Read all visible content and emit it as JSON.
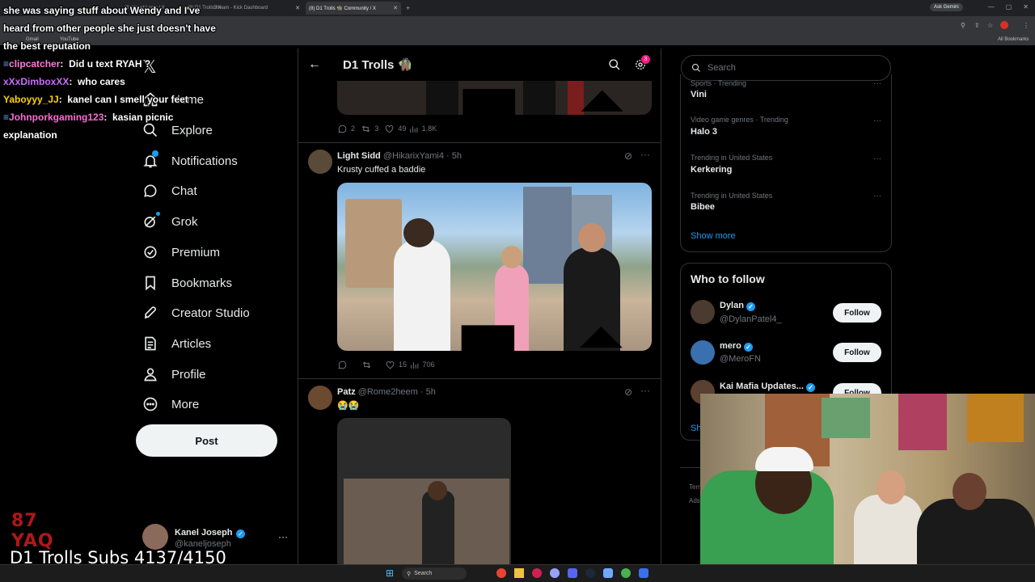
{
  "browser": {
    "tabs": [
      {
        "label": "(8) Weed Logic / X",
        "active": false
      },
      {
        "label": "(8) D1 Trolls / X",
        "active": false
      },
      {
        "label": "Stream - Kick Dashboard",
        "active": false
      },
      {
        "label": "(8) D1 Trolls 🧌 Community / X",
        "active": true
      }
    ],
    "ask_gemini": "Ask Gemini",
    "bookmarks": [
      "Gmail",
      "YouTube"
    ],
    "all_bookmarks": "All Bookmarks"
  },
  "stream_chat": [
    {
      "text": "she was saying stuff about Wendy and I've",
      "color": "#ffffff"
    },
    {
      "text": "heard from other people she just doesn't have",
      "color": "#ffffff"
    },
    {
      "text": "the best reputation",
      "color": "#ffffff"
    },
    {
      "user": "clipcatcher",
      "msg": "Did u text RYAH ?",
      "color": "#ff7ad9"
    },
    {
      "user": "xXxDimboxXX",
      "msg": "who cares",
      "color": "#c86bff"
    },
    {
      "user": "Yaboyyy_JJ",
      "msg": "kanel can I smell your feet",
      "color": "#ffd400"
    },
    {
      "user": "Johnporkgaming123",
      "msg": "kasian picnic",
      "color": "#ff6ad5"
    },
    {
      "text": "explanation",
      "color": "#ffffff"
    }
  ],
  "subs_counter": "D1 Trolls Subs 4137/4150",
  "logo_text": "87 YAQ",
  "nav": {
    "items": [
      {
        "label": "Home",
        "icon": "home-icon"
      },
      {
        "label": "Explore",
        "icon": "search-icon"
      },
      {
        "label": "Notifications",
        "icon": "bell-icon"
      },
      {
        "label": "Chat",
        "icon": "chat-icon"
      },
      {
        "label": "Grok",
        "icon": "grok-icon"
      },
      {
        "label": "Premium",
        "icon": "premium-icon"
      },
      {
        "label": "Bookmarks",
        "icon": "bookmark-icon"
      },
      {
        "label": "Creator Studio",
        "icon": "rocket-icon"
      },
      {
        "label": "Articles",
        "icon": "articles-icon"
      },
      {
        "label": "Profile",
        "icon": "profile-icon"
      },
      {
        "label": "More",
        "icon": "more-icon"
      }
    ],
    "post_label": "Post",
    "account": {
      "name": "Kanel Joseph",
      "handle": "@kaneljoseph"
    }
  },
  "community": {
    "title": "D1 Trolls 🧌",
    "settings_badge": "3"
  },
  "posts": [
    {
      "replies": "2",
      "reposts": "3",
      "likes": "49",
      "views": "1.8K"
    },
    {
      "author": "Light Sidd",
      "handle": "@HikarixYami4",
      "time": "· 5h",
      "text": "Krusty cuffed a baddie",
      "replies": "",
      "reposts": "",
      "likes": "15",
      "views": "706"
    },
    {
      "author": "Patz",
      "handle": "@Rome2heem",
      "time": "· 5h",
      "text": "😭😭"
    }
  ],
  "search": {
    "placeholder": "Search"
  },
  "trends": [
    {
      "meta": "Sports · Trending",
      "title": "Vini"
    },
    {
      "meta": "Video game genres · Trending",
      "title": "Halo 3"
    },
    {
      "meta": "Trending in United States",
      "title": "Kerkering"
    },
    {
      "meta": "Trending in United States",
      "title": "Bibee"
    }
  ],
  "show_more": "Show more",
  "who_to_follow": {
    "title": "Who to follow",
    "accounts": [
      {
        "name": "Dylan",
        "handle": "@DylanPatel4_",
        "follow": "Follow"
      },
      {
        "name": "mero",
        "handle": "@MeroFN",
        "follow": "Follow"
      },
      {
        "name": "Kai Mafia Updates...",
        "handle": "",
        "follow": "Follow"
      }
    ],
    "show_label": "Sh"
  },
  "footer_fragments": [
    "Terr",
    "Ads"
  ],
  "taskbar": {
    "search_label": "Search"
  },
  "colors": {
    "accent": "#1d9bf0",
    "background": "#000000",
    "border": "#2f3336",
    "muted": "#71767b"
  }
}
